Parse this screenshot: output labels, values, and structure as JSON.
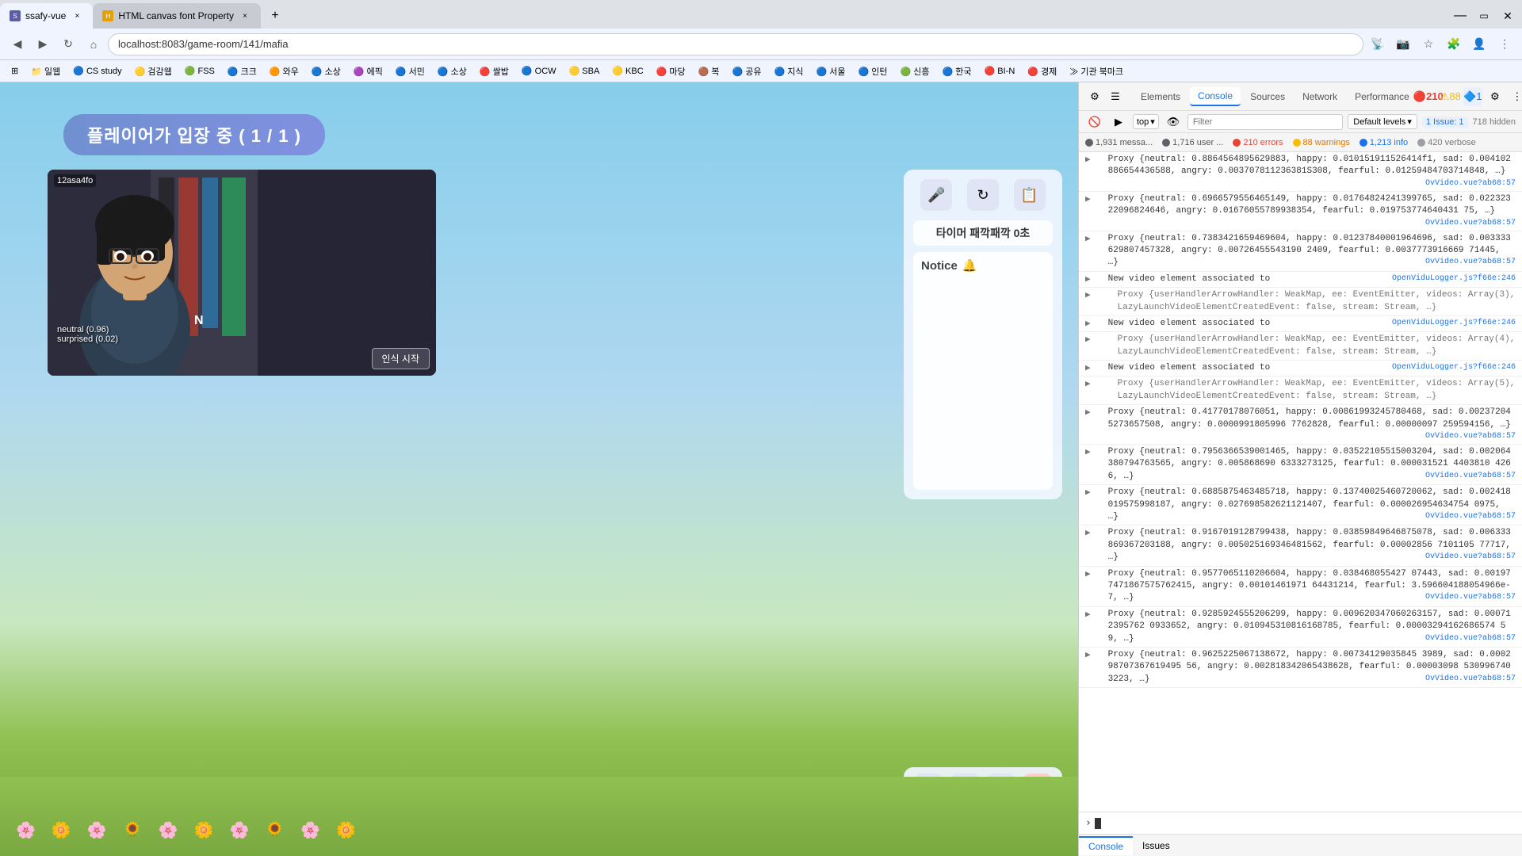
{
  "browser": {
    "tabs": [
      {
        "id": "tab1",
        "title": "ssafy-vue",
        "active": true,
        "favicon": "S"
      },
      {
        "id": "tab2",
        "title": "HTML canvas font Property",
        "active": false,
        "favicon": "H"
      }
    ],
    "address": "localhost:8083/game-room/141/mafia",
    "nav": {
      "back": "◀",
      "forward": "▶",
      "refresh": "↻",
      "home": "⌂"
    }
  },
  "bookmarks": [
    "일웹",
    "CS study",
    "검감웹",
    "FSS",
    "크크",
    "와우",
    "소상",
    "에픽",
    "서민",
    "소상",
    "쌀밥",
    "OCW",
    "SBA",
    "KBC",
    "마당",
    "복",
    "공유",
    "지식",
    "서울",
    "인턴",
    "신흥",
    "한국",
    "BI-N",
    "경제",
    "기관 북마크"
  ],
  "game": {
    "banner": "플레이어가 입장 중 ( 1 / 1 )",
    "timer_label": "타이머 패깍패깍 0초",
    "notice_title": "Notice",
    "notice_icon": "🔔",
    "player_id": "12asa4fo",
    "emotion_line1": "neutral (0.96)",
    "emotion_line2": "surprised (0.02)",
    "start_btn": "인식 시작"
  },
  "controls": {
    "top_icon1": "🎤",
    "top_icon2": "↻",
    "top_icon3": "📋",
    "bot_icon1": "↔",
    "bot_icon2": "🎤",
    "bot_icon3": "📷",
    "bot_icon4": "✕"
  },
  "devtools": {
    "tabs": [
      "Elements",
      "Console",
      "Sources",
      "Network",
      "Performance"
    ],
    "active_tab": "Console",
    "error_count": "210",
    "warning_count": "88",
    "issue_count": "1",
    "size_label": "718 hidden",
    "filter_placeholder": "Filter",
    "level_label": "Default levels",
    "top_label": "top",
    "stats": [
      {
        "label": "1,931 messa...",
        "type": "msg"
      },
      {
        "label": "1,716 user ...",
        "type": "user"
      },
      {
        "label": "210 errors",
        "type": "err"
      },
      {
        "label": "88 warnings",
        "type": "warn"
      },
      {
        "label": "1,213 info",
        "type": "info"
      },
      {
        "label": "420 verbose",
        "type": "verbose"
      }
    ],
    "logs": [
      {
        "id": 1,
        "type": "normal",
        "link": "OvVideo.vue?ab68:57",
        "text": "Proxy {neutral: 0.8864564895629883, happy: 0.010151911526414f1, sad: 0.004102886654436588, angry: 0.003707811236381S308, fearful: 0.01259484703714848, …}"
      },
      {
        "id": 2,
        "type": "normal",
        "link": "OvVideo.vue?ab68:57",
        "text": "Proxy {neutral: 0.6966579556465149, happy: 0.01764824241399765, sad: 0.02232322096824646, angry: 0.01676055789938354, fearful: 0.019753774640431 75, …}"
      },
      {
        "id": 3,
        "type": "normal",
        "link": "OvVideo.vue?ab68:57",
        "text": "Proxy {neutral: 0.7383421659469604, happy: 0.01237840001964696, sad: 0.003333629807457328, angry: 0.00726455543190 2409, fearful: 0.0037773916669 71445, …}"
      },
      {
        "id": 4,
        "type": "normal",
        "link": "OpenViduLogger.js?f66e:246",
        "text": "New video element associated to"
      },
      {
        "id": 5,
        "type": "normal",
        "link": null,
        "text": "Proxy {userHandlerArrowHandler: WeakMap, ee: EventEmitter, videos: Array(3), LazyLaunchVideoElementCreatedEvent: false, stream: Stream, …}"
      },
      {
        "id": 6,
        "type": "normal",
        "link": "OpenViduLogger.js?f66e:246",
        "text": "New video element associated to"
      },
      {
        "id": 7,
        "type": "normal",
        "link": null,
        "text": "Proxy {userHandlerArrowHandler: WeakMap, ee: EventEmitter, videos: Array(4), LazyLaunchVideoElementCreatedEvent: false, stream: Stream, …}"
      },
      {
        "id": 8,
        "type": "normal",
        "link": "OpenViduLogger.js?f66e:246",
        "text": "New video element associated to"
      },
      {
        "id": 9,
        "type": "normal",
        "link": null,
        "text": "Proxy {userHandlerArrowHandler: WeakMap, ee: EventEmitter, videos: Array(5), LazyLaunchVideoElementCreatedEvent: false, stream: Stream, …}"
      },
      {
        "id": 10,
        "type": "normal",
        "link": "OvVideo.vue?ab68:57",
        "text": "Proxy {neutral: 0.41770178076051, happy: 0.00861993245780468, sad: 0.002372045273657508, angry: 0.0000991805996 7762828, fearful: 0.00000097 259594156, …}"
      },
      {
        "id": 11,
        "type": "normal",
        "link": "OvVideo.vue?ab68:57",
        "text": "Proxy {neutral: 0.7956366539001465, happy: 0.03522105515003204, sad: 0.002064380794763565, angry: 0.005868690 6333273125, fearful: 0.000031521 4403810 4266, …}"
      },
      {
        "id": 12,
        "type": "normal",
        "link": "OvVideo.vue?ab68:57",
        "text": "Proxy {neutral: 0.6885875463485718, happy: 0.13740025460720062, sad: 0.002418019575998187, angry: 0.027698582621121407, fearful: 0.000026954634754 0975, …}"
      },
      {
        "id": 13,
        "type": "normal",
        "link": "OvVideo.vue?ab68:57",
        "text": "Proxy {neutral: 0.9167019128799438, happy: 0.03859849646875078, sad: 0.006333869367203188, angry: 0.005025169346481562, fearful: 0.00002856 7101105 77717, …}"
      },
      {
        "id": 14,
        "type": "normal",
        "link": "OvVideo.vue?ab68:57",
        "text": "Proxy {neutral: 0.9577065110206604, happy: 0.038468055427 07443, sad: 0.001977471867575762415, angry: 0.00101461971 64431214, fearful: 3.596604188054966e-7, …}"
      },
      {
        "id": 15,
        "type": "normal",
        "link": "OvVideo.vue?ab68:57",
        "text": "Proxy {neutral: 0.9285924555206299, happy: 0.009620347060263157, sad: 0.000712395762 0933652, angry: 0.010945310816168785, fearful: 0.00003294162686574 59, …}"
      },
      {
        "id": 16,
        "type": "normal",
        "link": "OvVideo.vue?ab68:57",
        "text": "Proxy {neutral: 0.9625225067138672, happy: 0.00734129035845 3989, sad: 0.000298707367619495 56, angry: 0.002818342065438628, fearful: 0.00003098 5309967403223, …}"
      }
    ],
    "bottom_tabs": [
      "Console",
      "Issues"
    ]
  }
}
